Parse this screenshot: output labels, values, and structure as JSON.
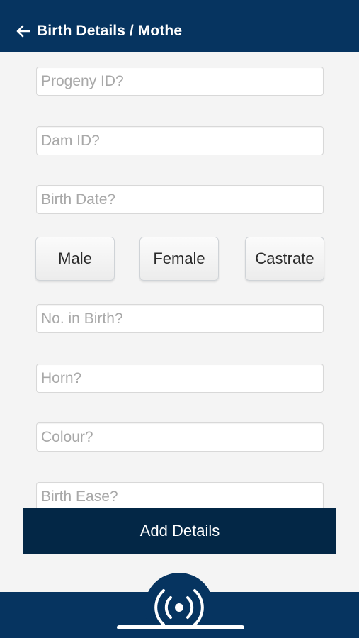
{
  "header": {
    "title": "Birth Details / Mothe",
    "back_icon": "arrow-left-icon"
  },
  "fields": {
    "progeny_id": {
      "placeholder": "Progeny ID?",
      "value": ""
    },
    "dam_id": {
      "placeholder": "Dam ID?",
      "value": ""
    },
    "birth_date": {
      "placeholder": "Birth Date?",
      "value": ""
    },
    "no_in_birth": {
      "placeholder": "No. in Birth?",
      "value": ""
    },
    "horn": {
      "placeholder": "Horn?",
      "value": ""
    },
    "colour": {
      "placeholder": "Colour?",
      "value": ""
    },
    "birth_ease": {
      "placeholder": "Birth Ease?",
      "value": ""
    }
  },
  "sex_options": {
    "male": "Male",
    "female": "Female",
    "castrate": "Castrate"
  },
  "actions": {
    "add_details": "Add Details"
  },
  "bottom_nav": {
    "center_icon": "broadcast-icon"
  },
  "colors": {
    "primary": "#063460",
    "button_dark": "#032746",
    "background": "#f4f4f4"
  }
}
